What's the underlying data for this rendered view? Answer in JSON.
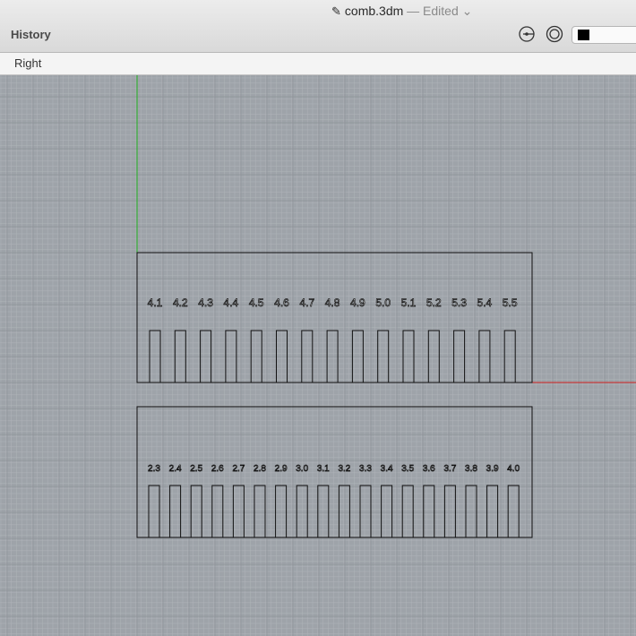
{
  "window": {
    "file_name": "comb.3dm",
    "status": "— Edited",
    "dropdown_chevron": "chevron-down-icon"
  },
  "toolbar": {
    "panel_title": "History",
    "buttons": [
      {
        "name": "osnap-point-icon"
      },
      {
        "name": "circle-target-icon"
      }
    ],
    "color_swatch": "#000000"
  },
  "viewport": {
    "name": "Right",
    "grid_color": "#b0b4ba",
    "background": "#9ea3a9",
    "x_axis_color": "#d02020",
    "y_axis_color": "#20b020"
  },
  "combs": [
    {
      "name": "upper-comb",
      "labels": [
        "4.1",
        "4.2",
        "4.3",
        "4.4",
        "4.5",
        "4.6",
        "4.7",
        "4.8",
        "4.9",
        "5.0",
        "5.1",
        "5.2",
        "5.3",
        "5.4",
        "5.5"
      ]
    },
    {
      "name": "lower-comb",
      "labels": [
        "2.3",
        "2.4",
        "2.5",
        "2.6",
        "2.7",
        "2.8",
        "2.9",
        "3.0",
        "3.1",
        "3.2",
        "3.3",
        "3.4",
        "3.5",
        "3.6",
        "3.7",
        "3.8",
        "3.9",
        "4.0"
      ]
    }
  ]
}
